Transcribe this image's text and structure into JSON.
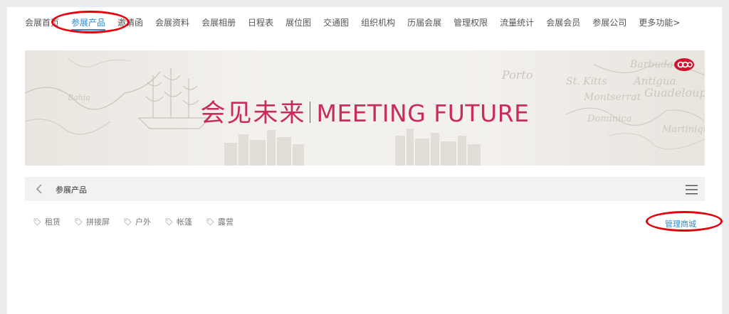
{
  "nav": {
    "items": [
      {
        "label": "会展首页"
      },
      {
        "label": "参展产品"
      },
      {
        "label": "邀请函"
      },
      {
        "label": "会展资料"
      },
      {
        "label": "会展相册"
      },
      {
        "label": "日程表"
      },
      {
        "label": "展位图"
      },
      {
        "label": "交通图"
      },
      {
        "label": "组织机构"
      },
      {
        "label": "历届会展"
      },
      {
        "label": "管理权限"
      },
      {
        "label": "流量统计"
      },
      {
        "label": "会展会员"
      },
      {
        "label": "参展公司"
      },
      {
        "label": "更多功能>"
      }
    ],
    "active_index": 1
  },
  "banner": {
    "title_cn": "会见未来",
    "title_en": "MEETING FUTURE"
  },
  "subheader": {
    "title": "参展产品"
  },
  "tags": [
    {
      "label": "租赁"
    },
    {
      "label": "拼接屏"
    },
    {
      "label": "户外"
    },
    {
      "label": "帐篷"
    },
    {
      "label": "露营"
    }
  ],
  "manage_link": "管理商城",
  "icons": {
    "back": "chevron-left-icon",
    "menu": "hamburger-menu-icon",
    "tag": "tag-icon",
    "logo": "brand-logo-icon"
  },
  "colors": {
    "accent": "#2a8ad0",
    "banner_text": "#c72c5c",
    "annotation": "#e8000d"
  }
}
